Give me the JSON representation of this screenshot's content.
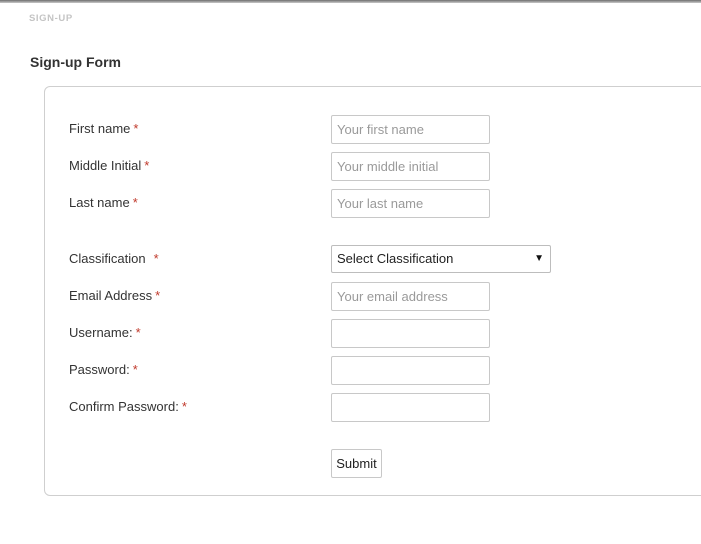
{
  "breadcrumb": "SIGN-UP",
  "page_title": "Sign-up Form",
  "required_marker": "*",
  "colors": {
    "required": "#c0392b",
    "text": "#333333",
    "placeholder": "#9a9a9a",
    "border": "#c8c8c8"
  },
  "form": {
    "first_name": {
      "label": "First name",
      "placeholder": "Your first name"
    },
    "middle_initial": {
      "label": "Middle Initial",
      "placeholder": "Your middle initial"
    },
    "last_name": {
      "label": "Last name",
      "placeholder": "Your last name"
    },
    "classification": {
      "label": "Classification",
      "selected": "Select Classification",
      "icon": "chevron-down-icon"
    },
    "email": {
      "label": "Email Address",
      "placeholder": "Your email address"
    },
    "username": {
      "label": "Username:",
      "placeholder": ""
    },
    "password": {
      "label": "Password:",
      "placeholder": ""
    },
    "confirm_password": {
      "label": "Confirm Password:",
      "placeholder": ""
    },
    "submit_label": "Submit"
  }
}
